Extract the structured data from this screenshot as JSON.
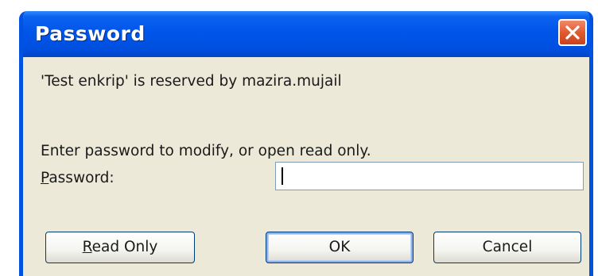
{
  "window": {
    "title": "Password",
    "close_icon": "close-icon"
  },
  "message": {
    "reserved_text": "'Test enkrip' is reserved by mazira.mujail",
    "instruction_text": "Enter password to modify, or open read only."
  },
  "password_field": {
    "label_mnemonic": "P",
    "label_rest": "assword:",
    "value": ""
  },
  "buttons": {
    "read_only_mnemonic": "R",
    "read_only_rest": "ead Only",
    "ok_label": "OK",
    "cancel_label": "Cancel"
  },
  "colors": {
    "titlebar": "#0055ea",
    "close_button": "#e25a2f",
    "dialog_background": "#ece9d8"
  }
}
